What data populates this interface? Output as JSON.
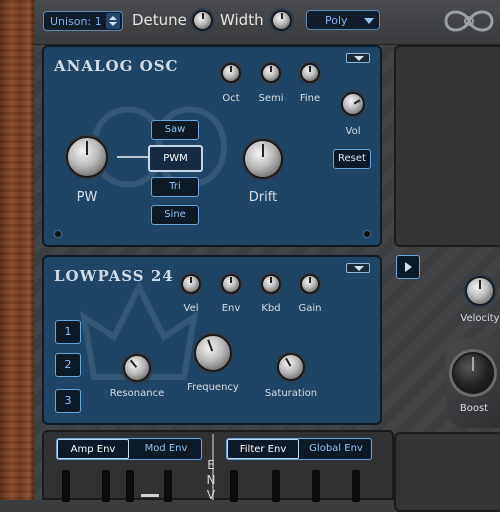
{
  "topbar": {
    "unison_value": "Unison: 1",
    "detune_label": "Detune",
    "width_label": "Width",
    "mode_value": "Poly"
  },
  "analog_osc": {
    "title": "ANALOG OSC",
    "knobs": {
      "oct": "Oct",
      "semi": "Semi",
      "fine": "Fine",
      "vol": "Vol",
      "pw": "PW",
      "drift": "Drift"
    },
    "waveforms": [
      "Saw",
      "PWM",
      "Tri",
      "Sine"
    ],
    "selected_waveform": "PWM",
    "reset_label": "Reset"
  },
  "lowpass": {
    "title": "LOWPASS 24",
    "knobs": {
      "vel": "Vel",
      "env": "Env",
      "kbd": "Kbd",
      "gain": "Gain",
      "resonance": "Resonance",
      "frequency": "Frequency",
      "saturation": "Saturation"
    },
    "slots": [
      "1",
      "2",
      "3"
    ]
  },
  "right": {
    "velocity_label": "Velocity",
    "boost_label": "Boost"
  },
  "envelope": {
    "tabs_left": [
      "Amp Env",
      "Mod Env"
    ],
    "tabs_right": [
      "Filter Env",
      "Global Env"
    ],
    "vertical_label": "ENV",
    "selected_left": "Amp Env",
    "selected_right": "Filter Env"
  },
  "colors": {
    "panel_blue": "#1f4566",
    "accent": "#6aa5dc",
    "text_light": "#d6dde4"
  }
}
